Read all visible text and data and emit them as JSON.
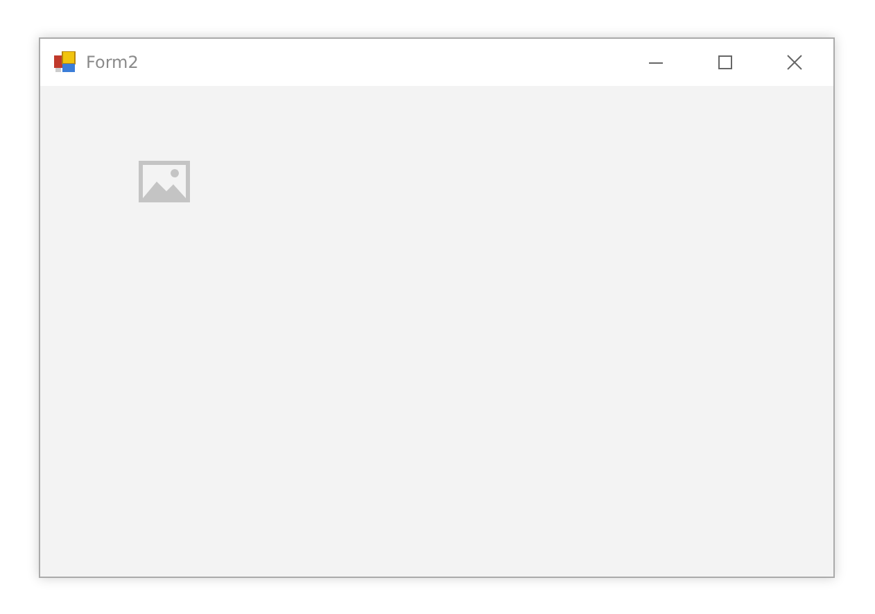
{
  "window": {
    "title": "Form2"
  }
}
